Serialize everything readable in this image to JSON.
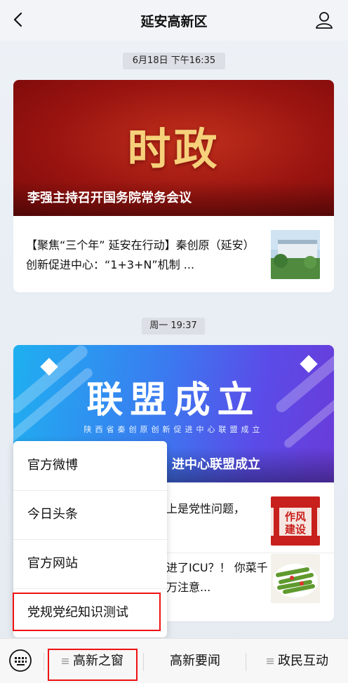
{
  "header": {
    "title": "延安高新区"
  },
  "feed": {
    "timestamp1": "6月18日 下午16:35",
    "card1": {
      "banner_text": "时政",
      "banner_caption": "李强主持召开国务院常务会议",
      "item_text": "【聚焦“三个年” 延安在行动】秦创原（延安）创新促进中心：“1+3+N”机制 ..."
    },
    "timestamp2": "周一 19:37",
    "card2": {
      "banner_text": "联盟成立",
      "banner_sub": "陕西省秦创原创新促进中心联盟成立",
      "banner_caption": "进中心联盟成立",
      "item1_text": "上是党性问题，",
      "item1_thumb_text": "作风建设",
      "item2_text": "进了ICU？！ 你菜千万注意..."
    }
  },
  "popup_menu": {
    "items": [
      "官方微博",
      "今日头条",
      "官方网站",
      "党规党纪知识测试"
    ]
  },
  "tabbar": {
    "tabs": [
      "高新之窗",
      "高新要闻",
      "政民互动"
    ]
  },
  "colors": {
    "highlight": "#ee1111",
    "accent_red": "#9a1410"
  }
}
